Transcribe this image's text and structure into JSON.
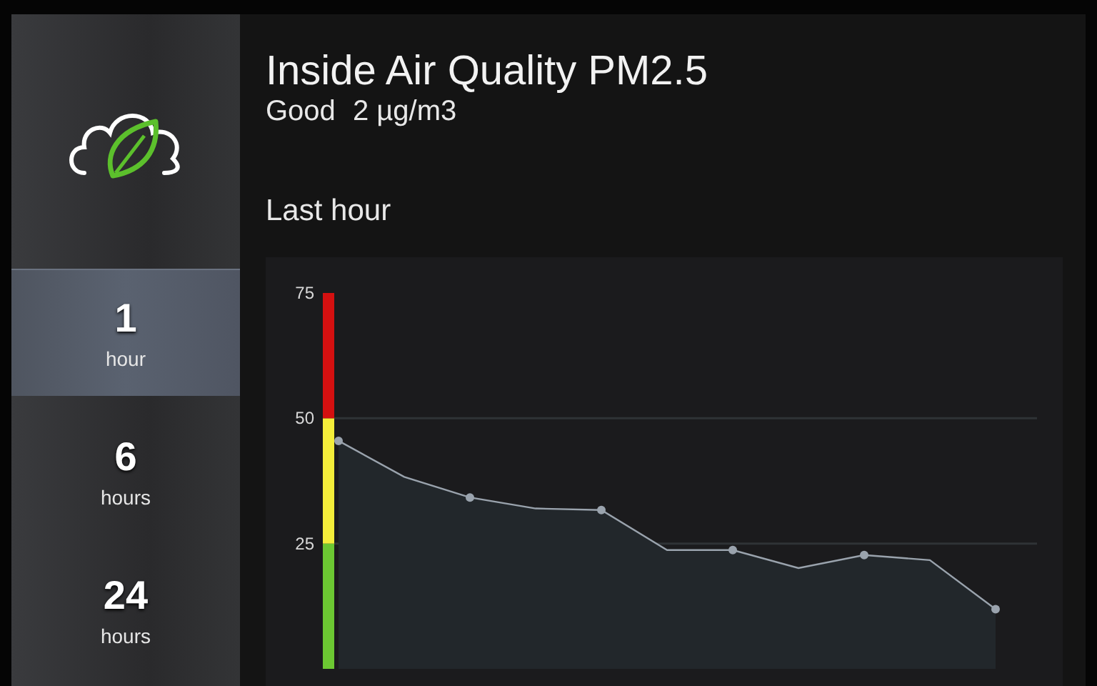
{
  "header": {
    "title": "Inside Air Quality PM2.5",
    "status": "Good",
    "reading": "2 µg/m3"
  },
  "section_title": "Last hour",
  "periods": [
    {
      "value": "1",
      "unit": "hour",
      "selected": true
    },
    {
      "value": "6",
      "unit": "hours",
      "selected": false
    },
    {
      "value": "24",
      "unit": "hours",
      "selected": false
    }
  ],
  "chart": {
    "chart_data": {
      "type": "area",
      "series": [
        {
          "color": "#9aa3ad",
          "values": [
            45.5,
            38.3,
            34.2,
            32,
            31.7,
            23.7,
            23.7,
            20.1,
            22.7,
            21.7,
            11.9
          ]
        }
      ],
      "ylim": [
        0,
        75
      ],
      "yticks": [
        25,
        50,
        75
      ]
    },
    "scale_colors": [
      {
        "color": "#6cc832"
      },
      {
        "color": "#f4ee3a"
      },
      {
        "color": "#d41010"
      }
    ]
  }
}
